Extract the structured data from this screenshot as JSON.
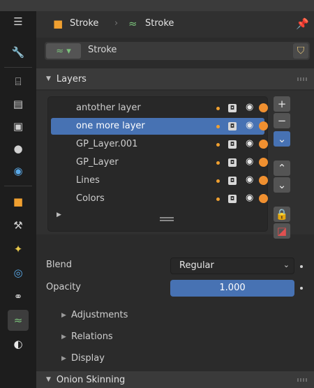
{
  "header": {
    "object_name": "Stroke",
    "data_name": "Stroke"
  },
  "datablock": {
    "name": "Stroke"
  },
  "layers_panel": {
    "title": "Layers",
    "layers": [
      {
        "name": "antother layer",
        "selected": false
      },
      {
        "name": "one more layer",
        "selected": true
      },
      {
        "name": "GP_Layer.001",
        "selected": false
      },
      {
        "name": "GP_Layer",
        "selected": false
      },
      {
        "name": "Lines",
        "selected": false
      },
      {
        "name": "Colors",
        "selected": false
      }
    ]
  },
  "properties": {
    "blend_label": "Blend",
    "blend_value": "Regular",
    "opacity_label": "Opacity",
    "opacity_value": "1.000"
  },
  "subpanels": [
    "Adjustments",
    "Relations",
    "Display"
  ],
  "onion_panel": {
    "title": "Onion Skinning"
  },
  "colors": {
    "accent": "#4772b3",
    "layer_dot": "#f0a030",
    "onion": "#f09030",
    "data_icon": "#7cc47c"
  },
  "icons": {
    "sidebar": [
      "tool-icon",
      "render-icon",
      "output-icon",
      "view-layer-icon",
      "scene-icon",
      "world-icon",
      "object-icon",
      "modifier-icon",
      "effects-icon",
      "physics-icon",
      "constraints-icon",
      "data-icon",
      "material-icon"
    ]
  }
}
